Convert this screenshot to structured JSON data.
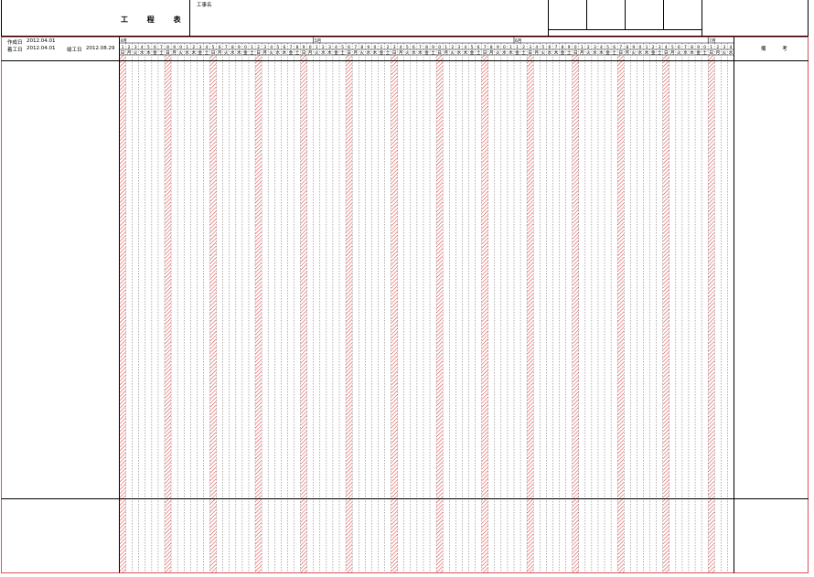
{
  "header": {
    "title": "工 程 表",
    "project_label": "工事名"
  },
  "info": {
    "created_label": "作成日",
    "created_date": "2012.04.01",
    "start_label": "着工日",
    "start_date": "2012.04.01",
    "end_label": "竣工日",
    "end_date": "2012.08.29"
  },
  "remarks_label": "備 考",
  "calendar": {
    "months": [
      "4月",
      "5月",
      "6月",
      "7月"
    ],
    "weekdays": [
      "日",
      "月",
      "火",
      "水",
      "木",
      "金",
      "土"
    ],
    "start_weekday_index": 0,
    "day_count": 95
  },
  "colors": {
    "outer_border": "#e0505a",
    "sunday_hatch": "#e04040",
    "grid": "#555555"
  }
}
